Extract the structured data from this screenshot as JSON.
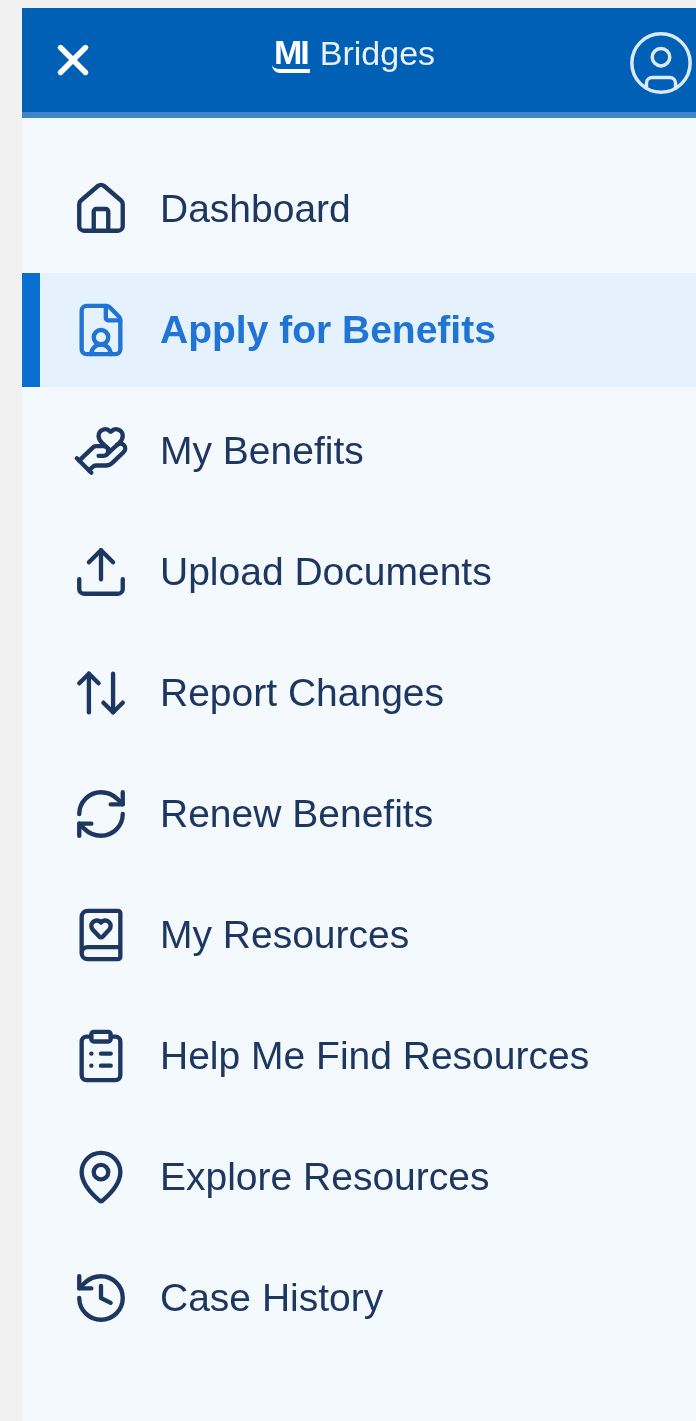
{
  "header": {
    "logo_mark": "MI",
    "title": "Bridges"
  },
  "menu": [
    {
      "label": "Dashboard",
      "selected": false
    },
    {
      "label": "Apply for Benefits",
      "selected": true
    },
    {
      "label": "My Benefits",
      "selected": false
    },
    {
      "label": "Upload Documents",
      "selected": false
    },
    {
      "label": "Report Changes",
      "selected": false
    },
    {
      "label": "Renew Benefits",
      "selected": false
    },
    {
      "label": "My Resources",
      "selected": false
    },
    {
      "label": "Help Me Find Resources",
      "selected": false
    },
    {
      "label": "Explore Resources",
      "selected": false
    },
    {
      "label": "Case History",
      "selected": false
    }
  ]
}
